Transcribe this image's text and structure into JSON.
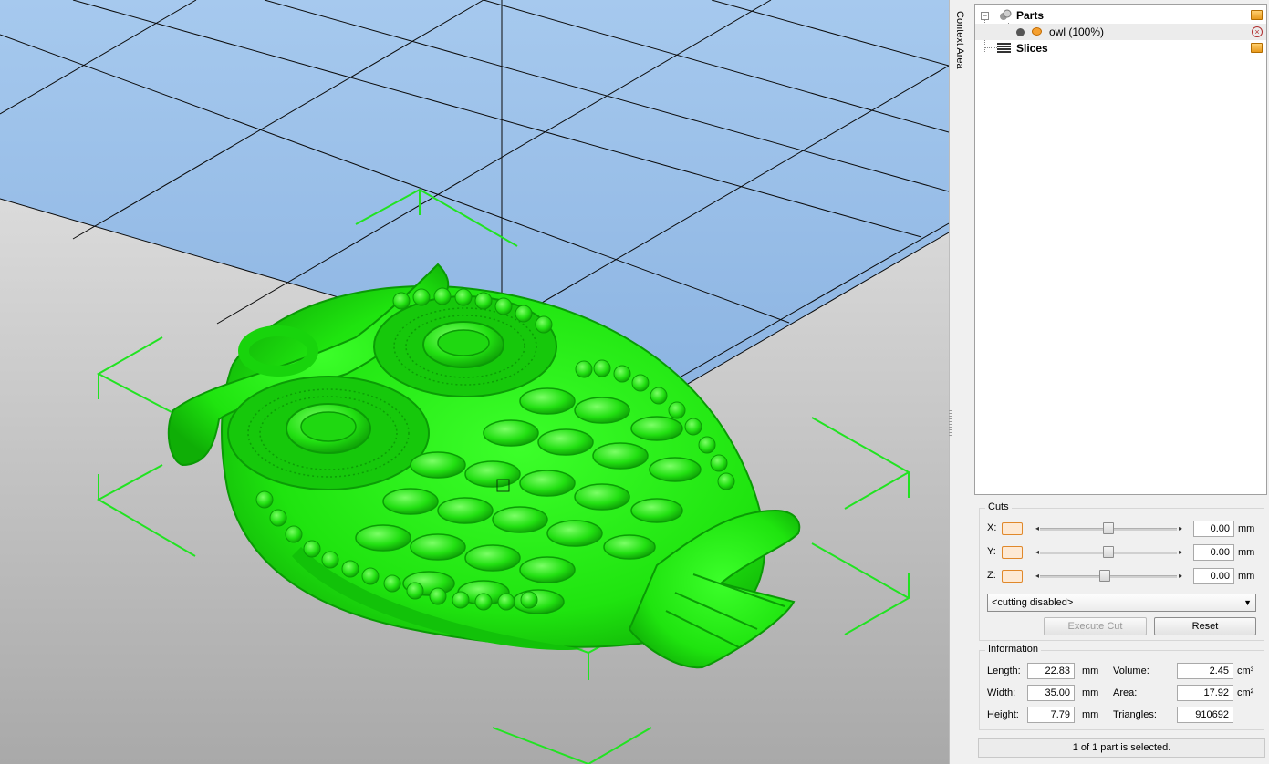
{
  "viewport": {
    "sky_color": "#9fc3ea",
    "floor_color": "#cfcfcf",
    "model_color": "#22ee11",
    "bbox_color": "#21e321"
  },
  "context_tab": {
    "label": "Context Area"
  },
  "tree": {
    "parts": {
      "label": "Parts",
      "icon": "parts-icon"
    },
    "owl": {
      "label": "owl (100%)",
      "icon": "visibility-icon"
    },
    "slices": {
      "label": "Slices",
      "icon": "slices-icon"
    }
  },
  "cuts": {
    "title": "Cuts",
    "axes": [
      {
        "label": "X:",
        "value": "0.00",
        "unit": "mm",
        "slider_position": 0.5
      },
      {
        "label": "Y:",
        "value": "0.00",
        "unit": "mm",
        "slider_position": 0.5
      },
      {
        "label": "Z:",
        "value": "0.00",
        "unit": "mm",
        "slider_position": 0.47
      }
    ],
    "mode": "<cutting disabled>",
    "execute_label": "Execute Cut",
    "reset_label": "Reset"
  },
  "information": {
    "title": "Information",
    "length": {
      "label": "Length:",
      "value": "22.83",
      "unit": "mm"
    },
    "width": {
      "label": "Width:",
      "value": "35.00",
      "unit": "mm"
    },
    "height": {
      "label": "Height:",
      "value": "7.79",
      "unit": "mm"
    },
    "volume": {
      "label": "Volume:",
      "value": "2.45",
      "unit": "cm³"
    },
    "area": {
      "label": "Area:",
      "value": "17.92",
      "unit": "cm²"
    },
    "triangles": {
      "label": "Triangles:",
      "value": "910692"
    }
  },
  "status": "1 of 1 part is selected."
}
